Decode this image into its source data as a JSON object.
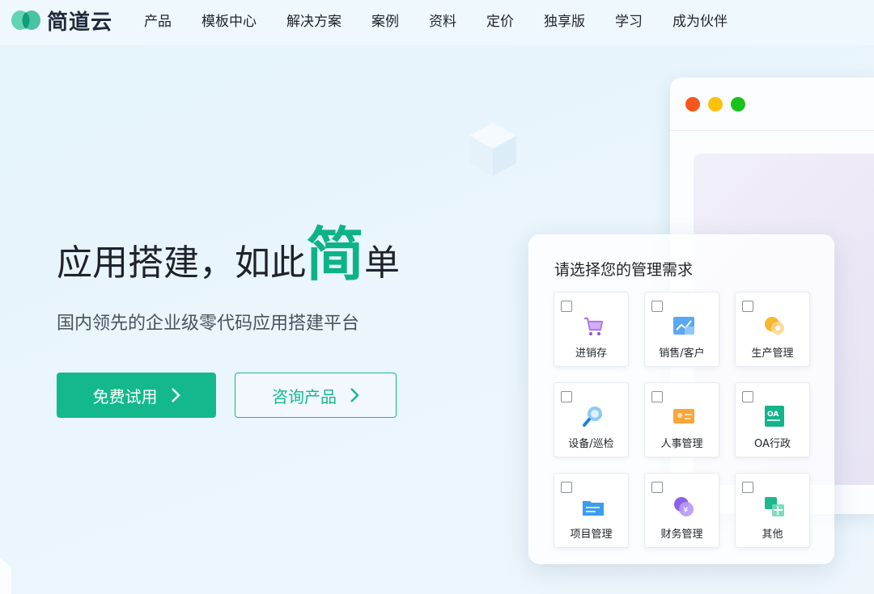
{
  "brand": {
    "name": "简道云",
    "accent": "#13b98c"
  },
  "nav": {
    "items": [
      "产品",
      "模板中心",
      "解决方案",
      "案例",
      "资料",
      "定价",
      "独享版",
      "学习",
      "成为伙伴"
    ]
  },
  "hero": {
    "title_part1": "应用搭建，如此",
    "title_highlight": "简",
    "title_part3": "单",
    "subtitle": "国内领先的企业级零代码应用搭建平台",
    "primary_button": "免费试用",
    "secondary_button": "咨询产品"
  },
  "card": {
    "title": "请选择您的管理需求",
    "options": [
      {
        "label": "进销存",
        "icon": "shopping-cart-icon",
        "checked": false
      },
      {
        "label": "销售/客户",
        "icon": "sales-chart-icon",
        "checked": false
      },
      {
        "label": "生产管理",
        "icon": "production-icon",
        "checked": false
      },
      {
        "label": "设备/巡检",
        "icon": "inspection-magnifier-icon",
        "checked": false
      },
      {
        "label": "人事管理",
        "icon": "id-card-icon",
        "checked": false
      },
      {
        "label": "OA行政",
        "icon": "oa-document-icon",
        "checked": false
      },
      {
        "label": "项目管理",
        "icon": "project-folder-icon",
        "checked": false
      },
      {
        "label": "财务管理",
        "icon": "finance-coin-icon",
        "checked": false
      },
      {
        "label": "其他",
        "icon": "other-grid-icon",
        "checked": false
      }
    ]
  }
}
